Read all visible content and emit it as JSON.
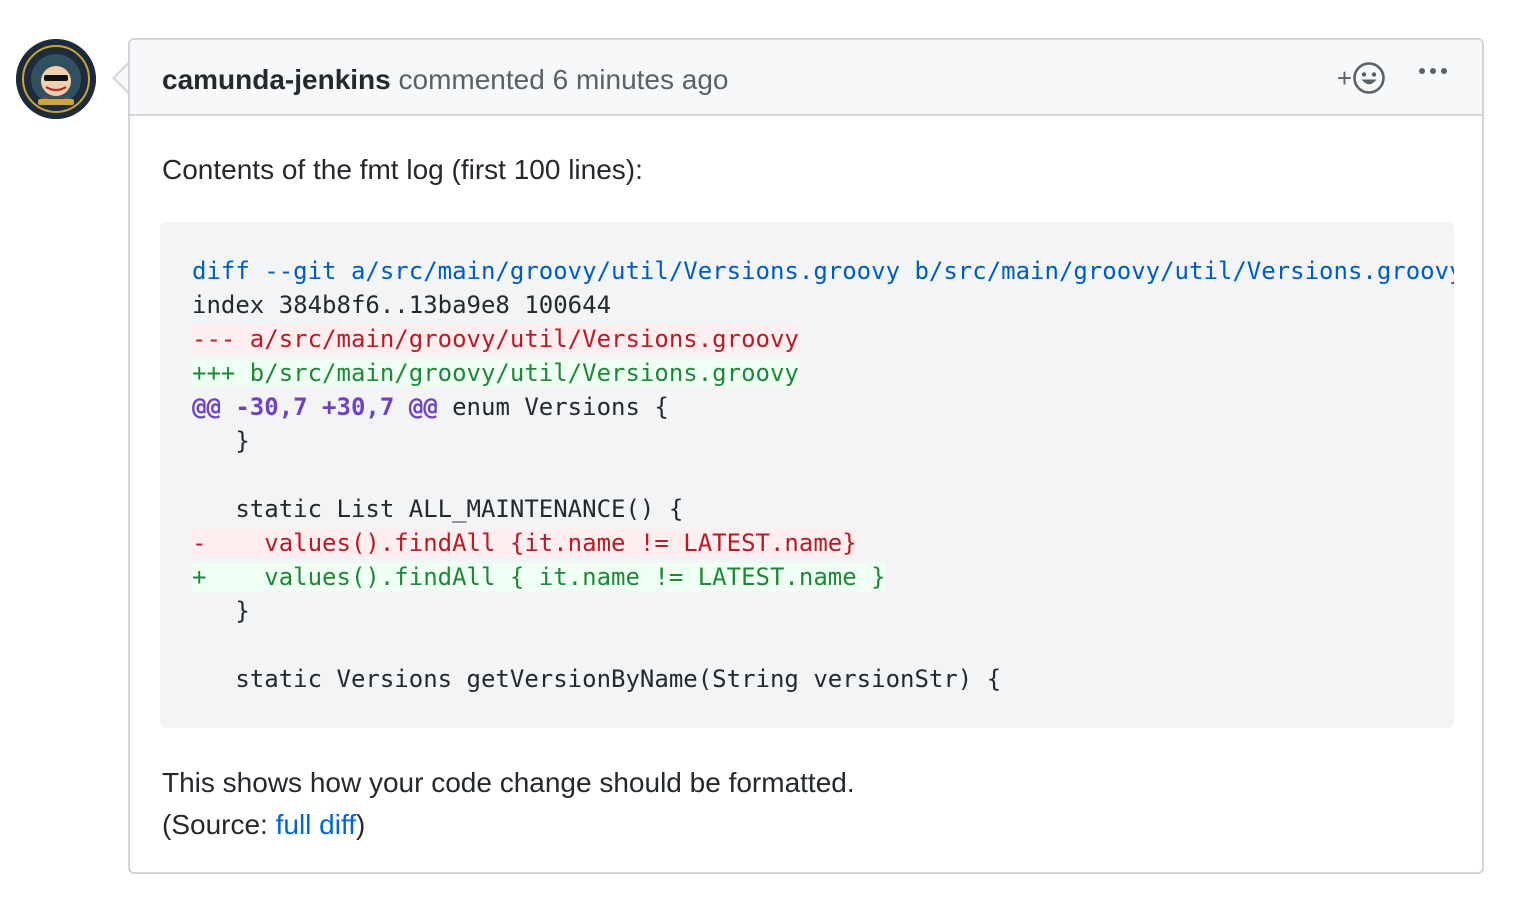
{
  "comment": {
    "author": "camunda-jenkins",
    "action": "commented",
    "time": "6 minutes ago",
    "reaction_plus": "+",
    "more_icon": "kebab-horizontal-icon",
    "reaction_icon": "smiley-icon",
    "avatar_icon": "jenkins-ci-ambassador-avatar"
  },
  "body": {
    "intro": "Contents of the fmt log (first 100 lines):",
    "outro_line1": "This shows how your code change should be formatted.",
    "outro_source_prefix": "(Source: ",
    "outro_link": "full diff",
    "outro_source_suffix": ")"
  },
  "code": {
    "line1": "diff --git a/src/main/groovy/util/Versions.groovy b/src/main/groovy/util/Versions.groovy",
    "line2": "index 384b8f6..13ba9e8 100644",
    "line3": "--- a/src/main/groovy/util/Versions.groovy",
    "line4": "+++ b/src/main/groovy/util/Versions.groovy",
    "line5_hunk": "@@ -30,7 +30,7 @@",
    "line5_rest": " enum Versions {",
    "line6": "   }",
    "line7": "",
    "line8": "   static List ALL_MAINTENANCE() {",
    "line9": "-    values().findAll {it.name != LATEST.name}",
    "line10": "+    values().findAll { it.name != LATEST.name }",
    "line11": "   }",
    "line12": "",
    "line13": "   static Versions getVersionByName(String versionStr) {"
  },
  "colors": {
    "meta": "#005cc5",
    "deletion": "#b31d28",
    "deletion_bg": "#ffeef0",
    "addition": "#22863a",
    "addition_bg": "#f0fff4",
    "hunk": "#6f42c1",
    "link": "#0366d6"
  }
}
